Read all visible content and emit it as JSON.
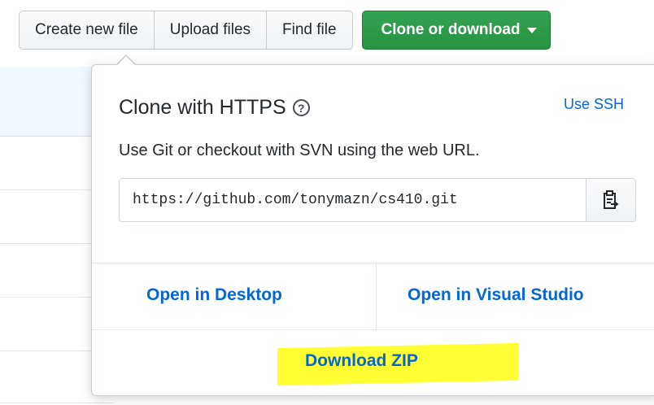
{
  "toolbar": {
    "create_new_file": "Create new file",
    "upload_files": "Upload files",
    "find_file": "Find file",
    "clone_or_download": "Clone or download"
  },
  "clone_popup": {
    "title": "Clone with HTTPS",
    "help_glyph": "?",
    "use_ssh": "Use SSH",
    "description": "Use Git or checkout with SVN using the web URL.",
    "url": "https://github.com/tonymazn/cs410.git",
    "open_in_desktop": "Open in Desktop",
    "open_in_visual_studio": "Open in Visual Studio",
    "download_zip": "Download ZIP"
  },
  "colors": {
    "primary_green": "#28a745",
    "link_blue": "#0366d6",
    "highlight_yellow": "#ffff33"
  },
  "icons": [
    "help-icon",
    "clipboard-icon",
    "caret-down-icon"
  ]
}
